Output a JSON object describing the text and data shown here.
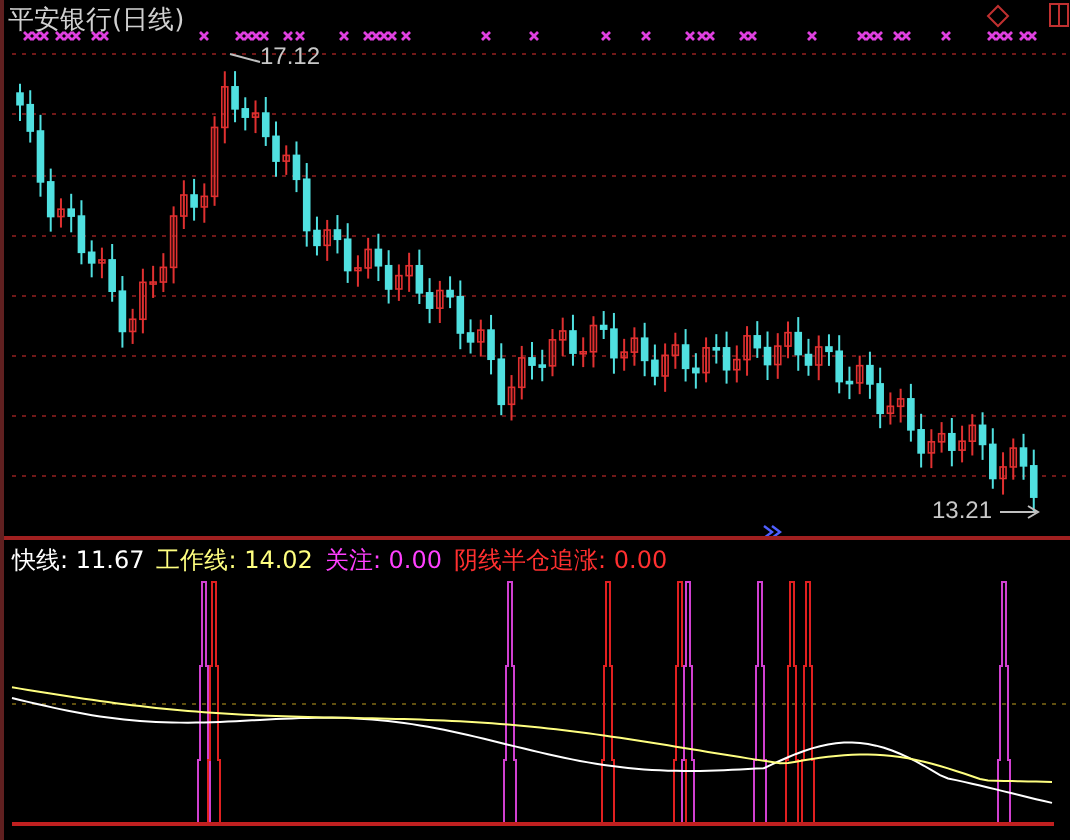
{
  "chart_title": "平安银行(日线)",
  "price_labels": {
    "high": "17.12",
    "low": "13.21"
  },
  "indicator_legend": [
    {
      "label": "快线:",
      "value": "11.67",
      "color": "#ffffff"
    },
    {
      "label": "工作线:",
      "value": "14.02",
      "color": "#ffff80"
    },
    {
      "label": "关注:",
      "value": "0.00",
      "color": "#ff40ff"
    },
    {
      "label": "阴线半仓追涨:",
      "value": "0.00",
      "color": "#ff3030"
    }
  ]
}
